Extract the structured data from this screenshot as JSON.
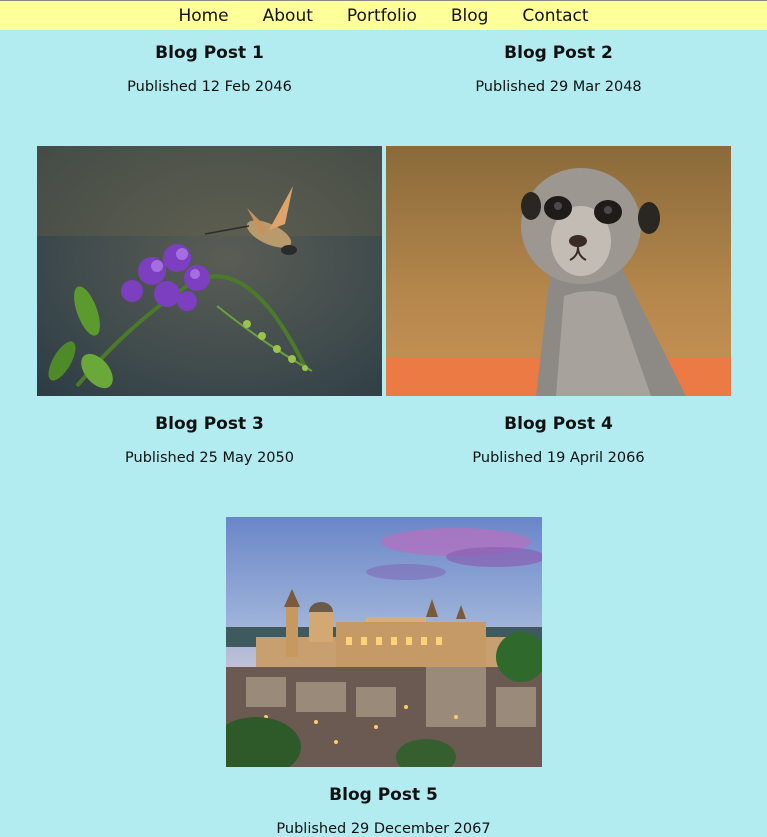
{
  "nav": {
    "items": [
      {
        "label": "Home"
      },
      {
        "label": "About"
      },
      {
        "label": "Portfolio"
      },
      {
        "label": "Blog"
      },
      {
        "label": "Contact"
      }
    ]
  },
  "posts": [
    {
      "title": "Blog Post 1",
      "date": "Published 12 Feb 2046"
    },
    {
      "title": "Blog Post 2",
      "date": "Published 29 Mar 2048"
    },
    {
      "title": "Blog Post 3",
      "date": "Published 25 May 2050",
      "image": "hummingbird-moth-flower"
    },
    {
      "title": "Blog Post 4",
      "date": "Published 19 April 2066",
      "image": "meerkat"
    },
    {
      "title": "Blog Post 5",
      "date": "Published 29 December 2067",
      "image": "hilltop-town-dusk"
    }
  ],
  "colors": {
    "background": "#b3ecf0",
    "nav_background": "#ffff99"
  }
}
